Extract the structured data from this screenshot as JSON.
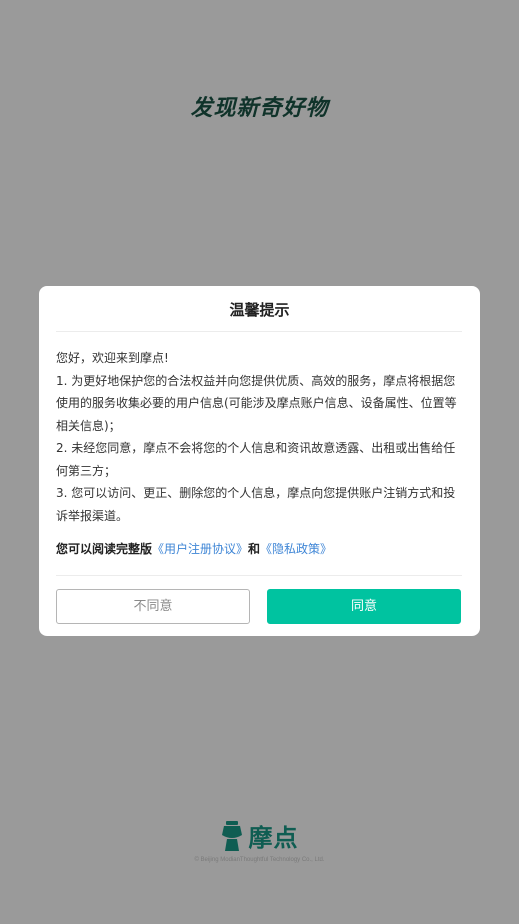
{
  "splash": {
    "slogan": "发现新奇好物",
    "brand_name": "摩点",
    "copyright": "© Beijing ModianThoughtful Technology Co., Ltd.",
    "brand_icon": "modian-logo-icon"
  },
  "dialog": {
    "title": "温馨提示",
    "greeting": "您好，欢迎来到摩点!",
    "item1": "1. 为更好地保护您的合法权益并向您提供优质、高效的服务，摩点将根据您使用的服务收集必要的用户信息(可能涉及摩点账户信息、设备属性、位置等相关信息)；",
    "item2": "2. 未经您同意，摩点不会将您的个人信息和资讯故意透露、出租或出售给任何第三方；",
    "item3": "3. 您可以访问、更正、删除您的个人信息，摩点向您提供账户注销方式和投诉举报渠道。",
    "read_prefix": "您可以阅读完整版",
    "user_agreement_link": "《用户注册协议》",
    "and_text": "和",
    "privacy_policy_link": "《隐私政策》",
    "disagree_label": "不同意",
    "agree_label": "同意"
  },
  "colors": {
    "overlay": "#9a9a9a",
    "accent": "#00c3a0",
    "link": "#3f86d6",
    "brand_dark": "#0f5d52"
  }
}
